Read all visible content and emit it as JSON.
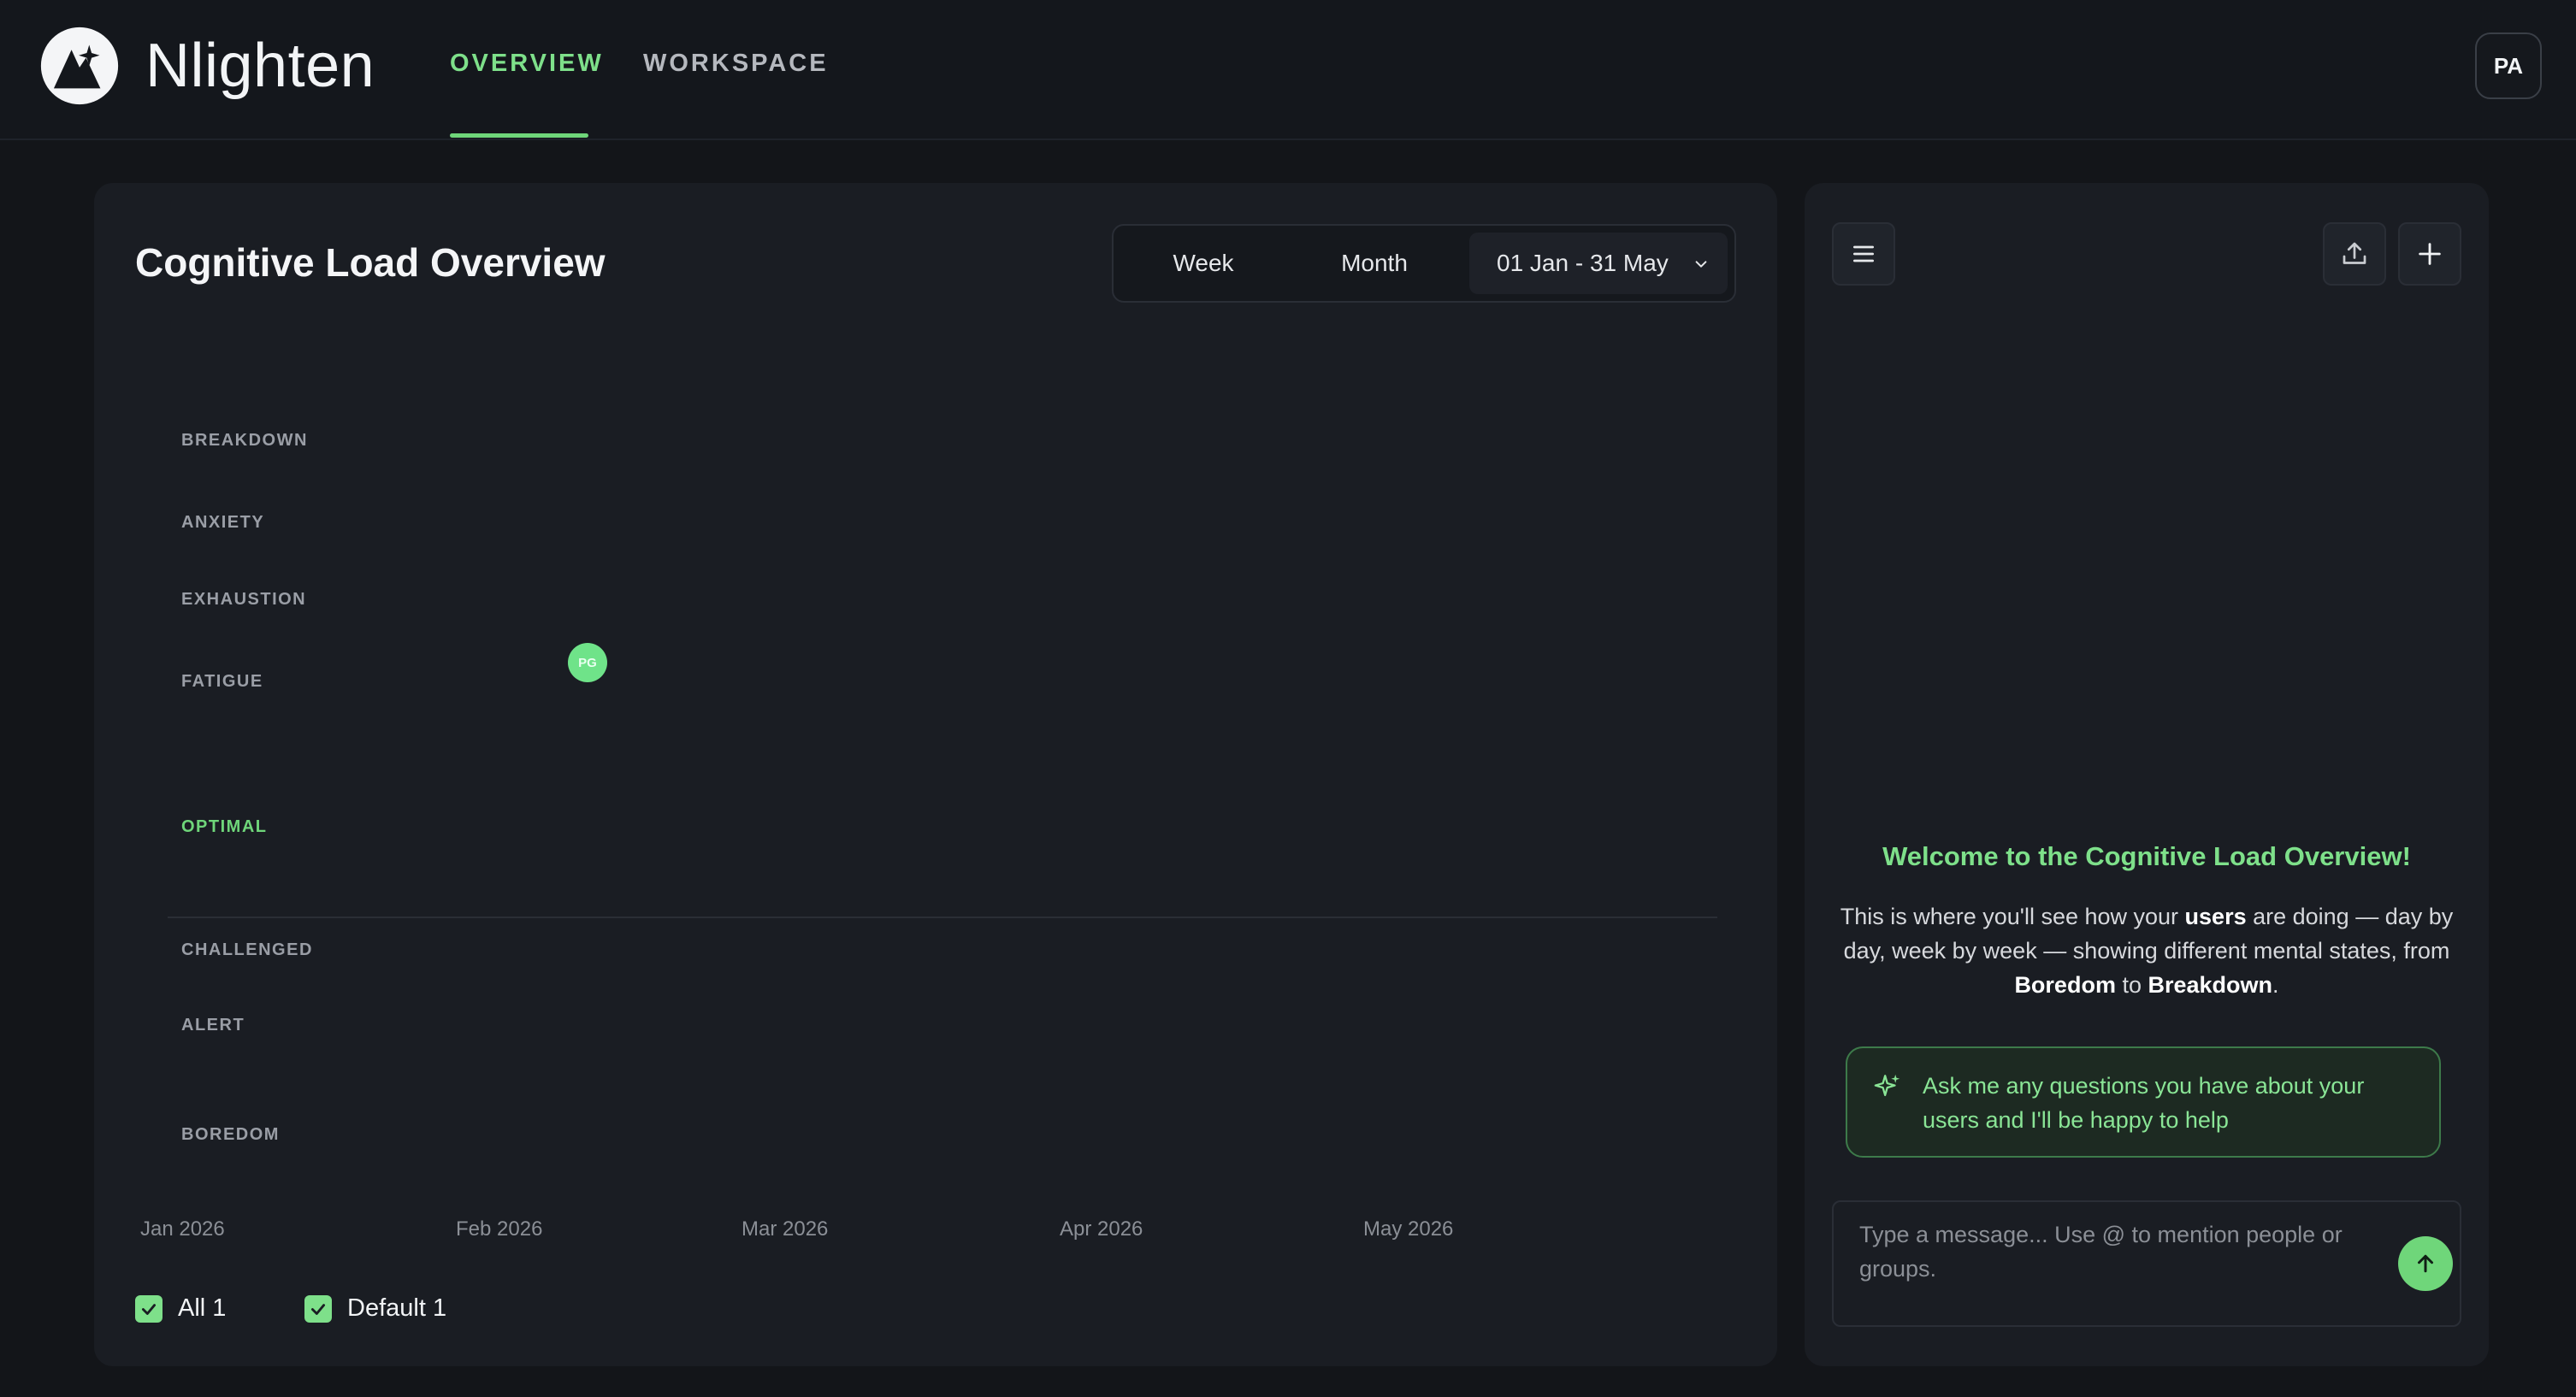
{
  "app": {
    "name": "Nlighten"
  },
  "nav": {
    "tabs": [
      {
        "label": "OVERVIEW",
        "active": true
      },
      {
        "label": "WORKSPACE",
        "active": false
      }
    ]
  },
  "user": {
    "initials": "PA"
  },
  "overview": {
    "title": "Cognitive Load Overview",
    "range_options": {
      "week": "Week",
      "month": "Month"
    },
    "date_range": "01 Jan - 31 May",
    "states": [
      "BREAKDOWN",
      "ANXIETY",
      "EXHAUSTION",
      "FATIGUE",
      "OPTIMAL",
      "CHALLENGED",
      "ALERT",
      "BOREDOM"
    ],
    "months": [
      "Jan 2026",
      "Feb 2026",
      "Mar 2026",
      "Apr 2026",
      "May 2026"
    ],
    "markers": [
      {
        "initials": "PG",
        "state": "FATIGUE"
      }
    ],
    "legend": [
      {
        "label": "All 1",
        "checked": true
      },
      {
        "label": "Default 1",
        "checked": true
      }
    ]
  },
  "assistant": {
    "welcome_title": "Welcome to the Cognitive Load Overview!",
    "welcome_parts": {
      "p1": "This is where you'll see how your ",
      "users": "users",
      "p2": " are doing — day by day, week by week — showing different mental states, from ",
      "boredom": "Boredom",
      "p3": " to ",
      "breakdown": "Breakdown",
      "p4": "."
    },
    "help_text": "Ask me any questions you have about your users and I'll be happy to help",
    "input_placeholder": "Type a message... Use @ to mention people or groups."
  },
  "colors": {
    "accent": "#6fd67a",
    "background": "#131519",
    "card": "#1a1d23"
  },
  "icons": [
    "logo-icon",
    "chevron-down-icon",
    "menu-icon",
    "upload-icon",
    "plus-icon",
    "sparkle-icon",
    "send-arrow-icon",
    "check-icon"
  ]
}
